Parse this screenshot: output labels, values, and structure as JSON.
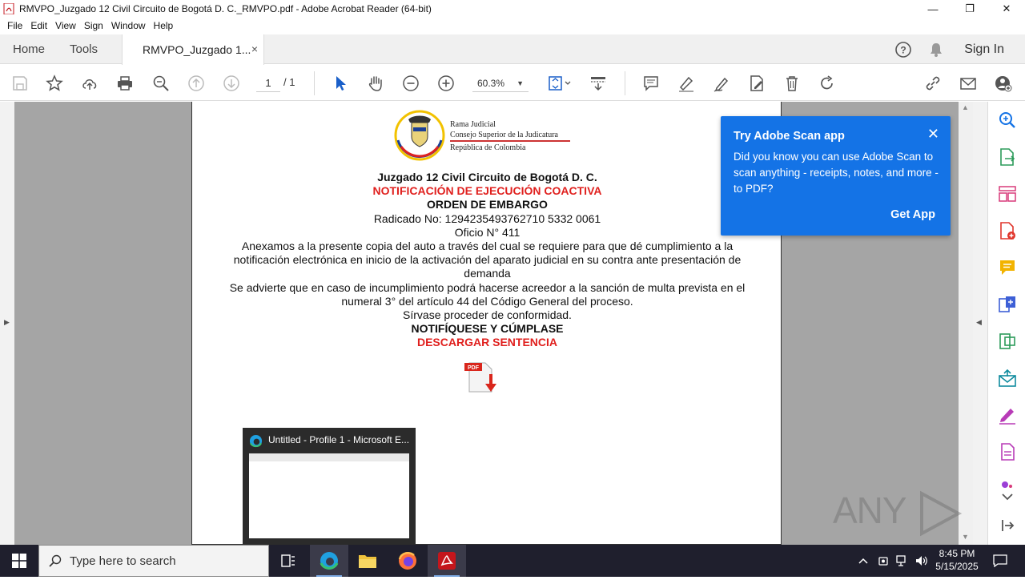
{
  "window": {
    "title": "RMVPO_Juzgado 12 Civil Circuito de Bogotá D. C._RMVPO.pdf - Adobe Acrobat Reader (64-bit)",
    "minimize": "—",
    "maximize": "❐",
    "close": "✕"
  },
  "menu": [
    "File",
    "Edit",
    "View",
    "Sign",
    "Window",
    "Help"
  ],
  "tabs": {
    "home": "Home",
    "tools": "Tools",
    "document": "RMVPO_Juzgado 1...",
    "close": "×",
    "sign_in": "Sign In"
  },
  "toolbar": {
    "page_current": "1",
    "page_total": "/ 1",
    "zoom": "60.3%"
  },
  "document": {
    "logo_lines": [
      "Rama Judicial",
      "Consejo Superior de la Judicatura",
      "República de Colombia"
    ],
    "court": "Juzgado 12 Civil Circuito de Bogotá D. C.",
    "notice": "NOTIFICACIÓN DE EJECUCIÓN COACTIVA",
    "order": "ORDEN DE EMBARGO",
    "radicado": "Radicado No: 1294235493762710 5332 0061",
    "oficio": "Oficio N° 411",
    "para1": "Anexamos a la presente copia del auto a través del cual se requiere para que dé cumplimiento a la notificación electrónica en inicio de la activación del aparato judicial en su contra  ante presentación de demanda",
    "para2": "Se advierte que en caso de incumplimiento podrá hacerse acreedor a la sanción de multa prevista en el numeral 3° del artículo 44 del Código General del proceso.",
    "closing": "Sírvase proceder de conformidad.",
    "notify": "NOTIFÍQUESE Y CÚMPLASE",
    "download": "DESCARGAR SENTENCIA",
    "pdf_badge": "PDF"
  },
  "popup": {
    "title": "Try Adobe Scan app",
    "body": "Did you know you can use Adobe Scan to scan anything - receipts, notes, and more - to PDF?",
    "cta": "Get App",
    "close": "✕"
  },
  "preview": {
    "title": "Untitled - Profile 1 - Microsoft E..."
  },
  "watermark": {
    "left": "ANY",
    "right": "RUN"
  },
  "taskbar": {
    "search_placeholder": "Type here to search",
    "time": "8:45 PM",
    "date": "5/15/2025"
  },
  "colors": {
    "accent_blue": "#1473e6",
    "acrobat_red": "#c4161c",
    "notice_red": "#e0201e",
    "taskbar": "#1f1f2d"
  }
}
